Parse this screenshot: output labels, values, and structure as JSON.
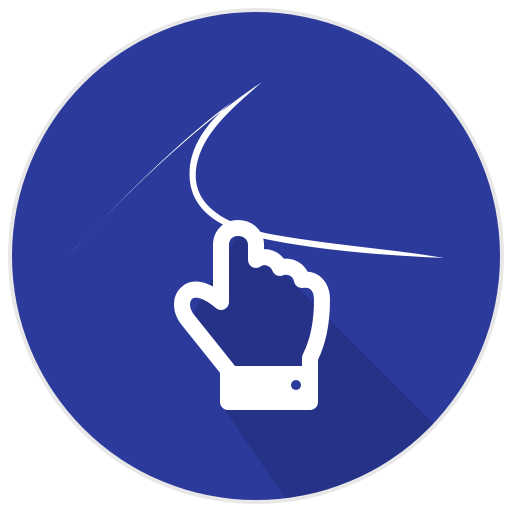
{
  "icon": {
    "semantic": "swipe-gesture-app-icon",
    "colors": {
      "background": "#ffffff",
      "badge": "#2b3a9b",
      "shadow": "#243184",
      "stroke": "#ffffff",
      "ring": "#d9d9d9"
    },
    "parts": [
      "circle-badge",
      "swipe-stroke",
      "pointing-hand-icon"
    ]
  }
}
